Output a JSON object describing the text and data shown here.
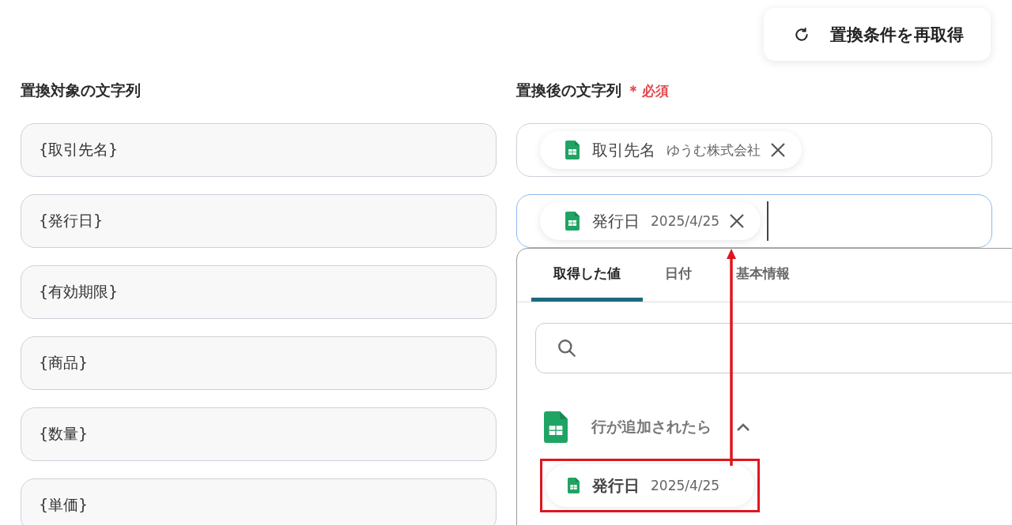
{
  "refresh_button": {
    "label": "置換条件を再取得"
  },
  "source_column": {
    "label": "置換対象の文字列",
    "fields": [
      {
        "value": "{取引先名}"
      },
      {
        "value": "{発行日}"
      },
      {
        "value": "{有効期限}"
      },
      {
        "value": "{商品}"
      },
      {
        "value": "{数量}"
      },
      {
        "value": "{単価}"
      }
    ]
  },
  "target_column": {
    "label": "置換後の文字列",
    "required_mark": "＊",
    "required_text": "必須",
    "fields": [
      {
        "focused": false,
        "tokens": [
          {
            "name": "取引先名",
            "value": "ゆうむ株式会社"
          }
        ]
      },
      {
        "focused": true,
        "tokens": [
          {
            "name": "発行日",
            "value": "2025/4/25"
          }
        ]
      }
    ]
  },
  "dropdown": {
    "tabs": [
      {
        "label": "取得した値",
        "selected": true
      },
      {
        "label": "日付",
        "selected": false
      },
      {
        "label": "基本情報",
        "selected": false
      }
    ],
    "group": {
      "title": "行が追加されたら",
      "expanded": true,
      "items": [
        {
          "name": "発行日",
          "value": "2025/4/25",
          "highlighted": true
        }
      ]
    }
  }
}
